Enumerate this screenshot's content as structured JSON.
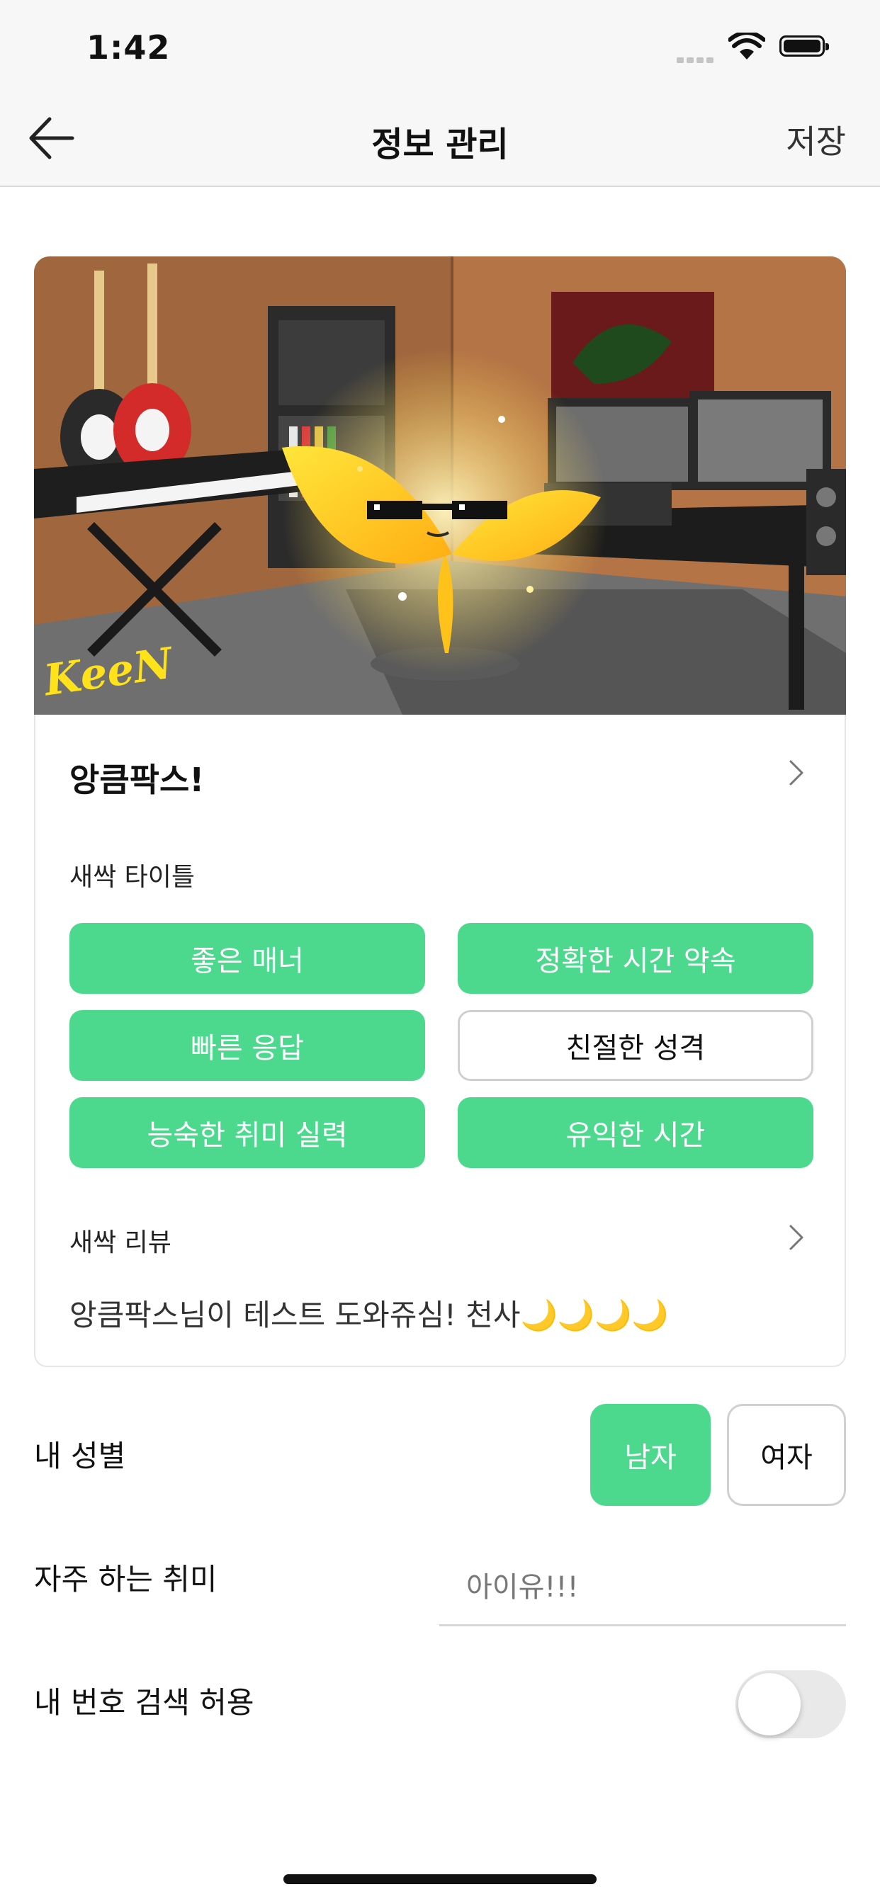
{
  "status_bar": {
    "time": "1:42"
  },
  "nav": {
    "title": "정보 관리",
    "save_label": "저장"
  },
  "banner": {
    "signature": "KeeN"
  },
  "profile": {
    "name": "앙큼팍스!",
    "title_section_label": "새싹 타이틀",
    "tags": [
      {
        "label": "좋은 매너",
        "selected": true
      },
      {
        "label": "정확한 시간 약속",
        "selected": true
      },
      {
        "label": "빠른 응답",
        "selected": true
      },
      {
        "label": "친절한 성격",
        "selected": false
      },
      {
        "label": "능숙한 취미 실력",
        "selected": true
      },
      {
        "label": "유익한 시간",
        "selected": true
      }
    ],
    "review_label": "새싹 리뷰",
    "review_text": "앙큼팍스님이 테스트 도와쥬심! 천사🌙🌙🌙🌙"
  },
  "gender": {
    "label": "내 성별",
    "male": "남자",
    "female": "여자",
    "selected": "남자"
  },
  "hobby": {
    "label": "자주 하는 취미",
    "value": "아이유!!!"
  },
  "phone_search": {
    "label": "내 번호 검색 허용",
    "enabled": false
  },
  "colors": {
    "accent": "#4cd98e",
    "border": "#d0d0d0",
    "nav_bg": "#f7f7f7"
  }
}
